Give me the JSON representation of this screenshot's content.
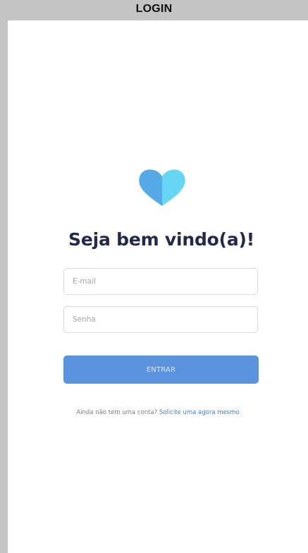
{
  "window": {
    "title": "LOGIN"
  },
  "logo": {
    "icon": "heart-icon",
    "colors": {
      "left": "#5c93df",
      "right": "#67d6f5",
      "overlap": "#4ec6f2"
    }
  },
  "login_form": {
    "welcome_title": "Seja bem vindo(a)!",
    "email": {
      "value": "",
      "placeholder": "E-mail"
    },
    "password": {
      "value": "",
      "placeholder": "Senha"
    },
    "submit_label": "ENTRAR",
    "signup_prompt": "Ainda não tem uma conta?",
    "signup_link": "Solicite uma agora mesmo"
  },
  "colors": {
    "frame_background": "#c4c4c4",
    "screen_background": "#ffffff",
    "title_text": "#22294d",
    "button_background": "#5c93df",
    "button_text": "#d9e7fb",
    "input_border": "#d7dce3",
    "placeholder_text": "#a2a8b3",
    "muted_text": "#777e88",
    "link_text": "#4d7ecf"
  }
}
